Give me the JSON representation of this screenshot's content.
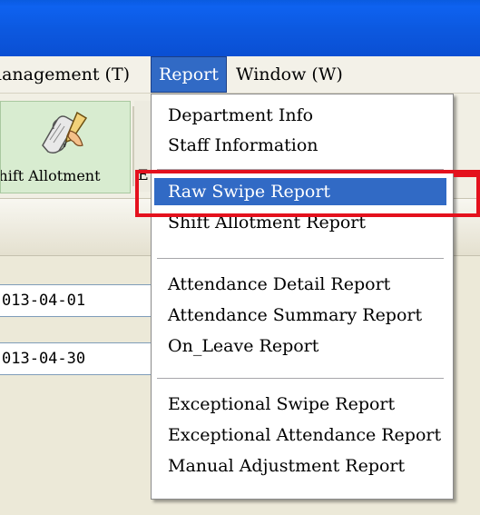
{
  "menubar": {
    "items": [
      {
        "label": "lanagement (T)"
      },
      {
        "label": "Report"
      },
      {
        "label": "Window (W)"
      }
    ]
  },
  "toolbar": {
    "shift_allotment_label": "Shift Allotment",
    "next_button_label": "E",
    "shift_allotment_icon": "quill-scroll-icon"
  },
  "fields": {
    "start_date": "013-04-01",
    "end_date": "013-04-30"
  },
  "report_menu": {
    "items": [
      {
        "label": "Department Info"
      },
      {
        "label": "Staff Information"
      },
      {
        "label": "Raw Swipe Report",
        "highlighted": true
      },
      {
        "label": "Shift Allotment Report"
      },
      {
        "label": "Attendance Detail Report"
      },
      {
        "label": "Attendance Summary Report"
      },
      {
        "label": "On_Leave Report"
      },
      {
        "label": "Exceptional Swipe Report"
      },
      {
        "label": "Exceptional Attendance Report"
      },
      {
        "label": "Manual Adjustment Report"
      }
    ]
  },
  "colors": {
    "titlebar": "#0A55DC",
    "menu_highlight": "#316AC5",
    "annotation_red": "#E4111D"
  }
}
